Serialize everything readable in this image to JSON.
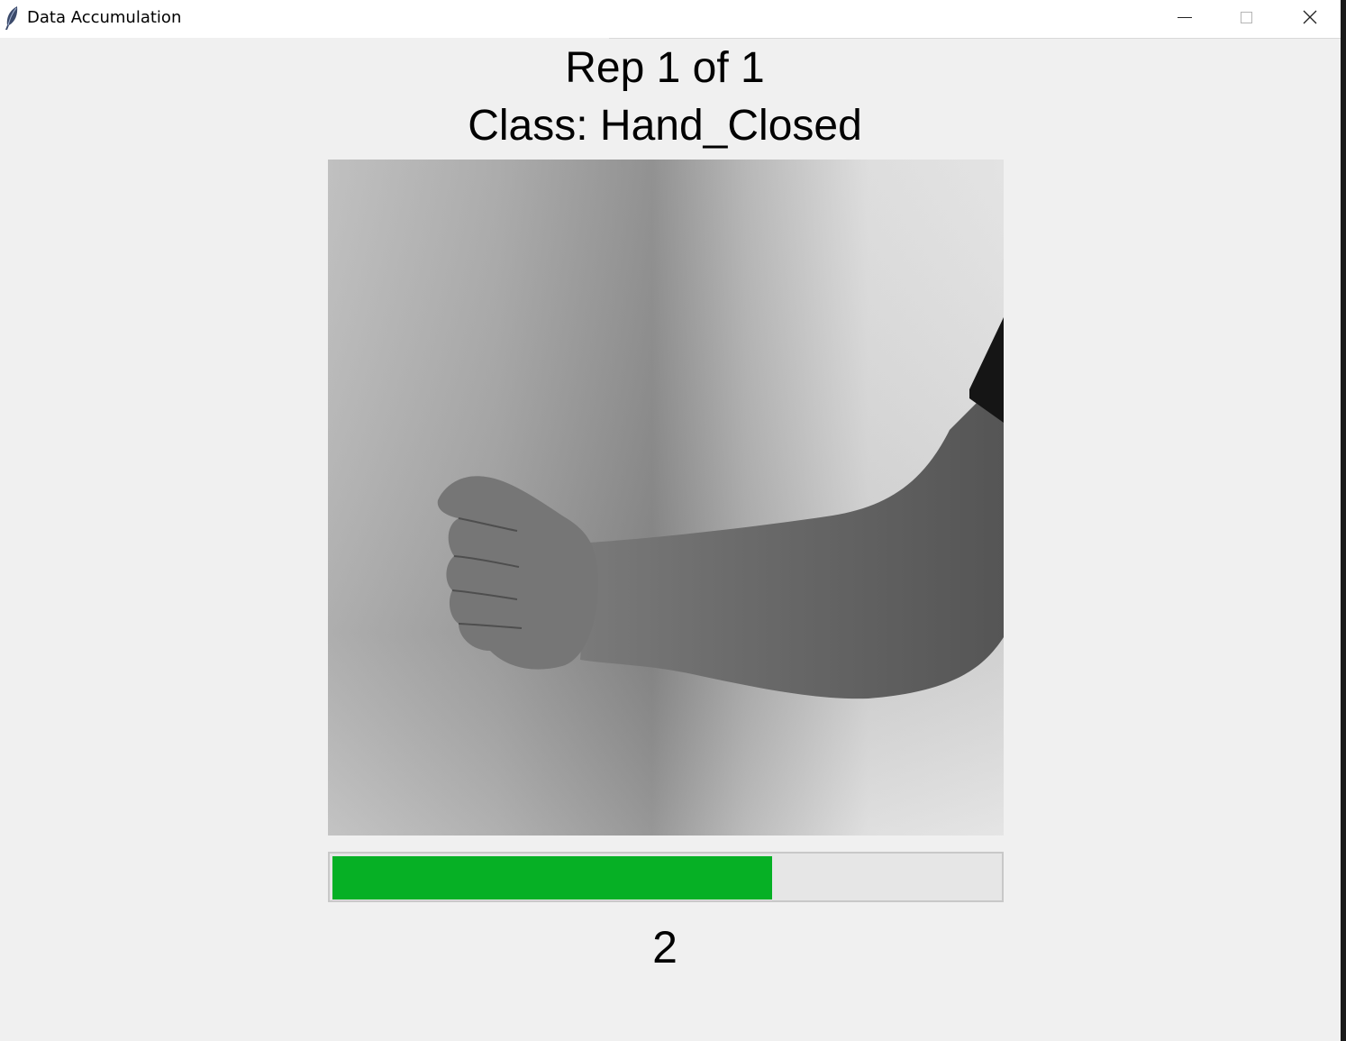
{
  "window": {
    "title": "Data Accumulation",
    "icon": "feather-icon",
    "controls": [
      "minimize-icon",
      "maximize-icon",
      "close-icon"
    ]
  },
  "main": {
    "rep_text": "Rep 1 of 1",
    "class_text": "Class: Hand_Closed",
    "image": {
      "subject": "grayscale photo of a closed fist and forearm"
    },
    "progress": {
      "fraction": 0.66,
      "color": "#06b025"
    },
    "countdown": "2"
  }
}
